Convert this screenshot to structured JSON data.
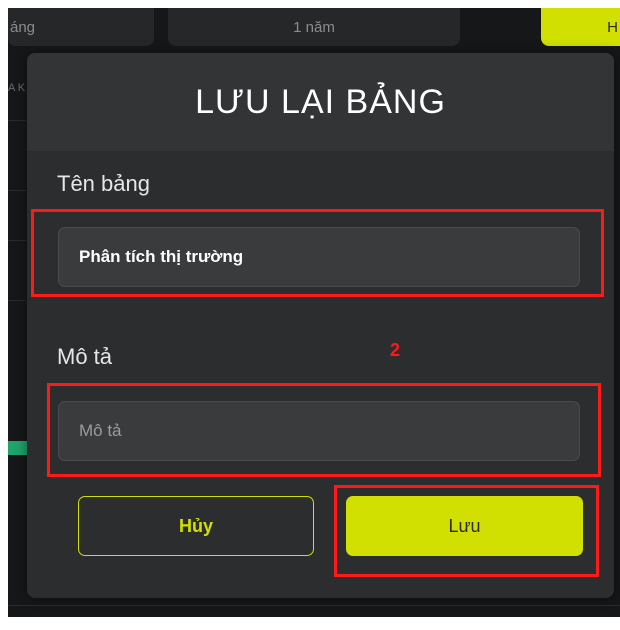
{
  "background": {
    "tabs": [
      {
        "label": "áng"
      },
      {
        "label": "1 năm"
      },
      {
        "label": "H"
      }
    ],
    "left_fragment": "A K"
  },
  "dialog": {
    "title": "LƯU LẠI BẢNG",
    "name_field": {
      "label": "Tên bảng",
      "value": "Phân tích thị trường"
    },
    "description_field": {
      "label": "Mô tả",
      "value": "",
      "placeholder": "Mô tả"
    },
    "cancel_label": "Hủy",
    "save_label": "Lưu"
  },
  "annotation": {
    "step_number": "2",
    "color": "#ff1a1a"
  },
  "colors": {
    "accent": "#d1e000",
    "dialog_bg": "#2c2d2f",
    "page_bg": "#161718"
  }
}
